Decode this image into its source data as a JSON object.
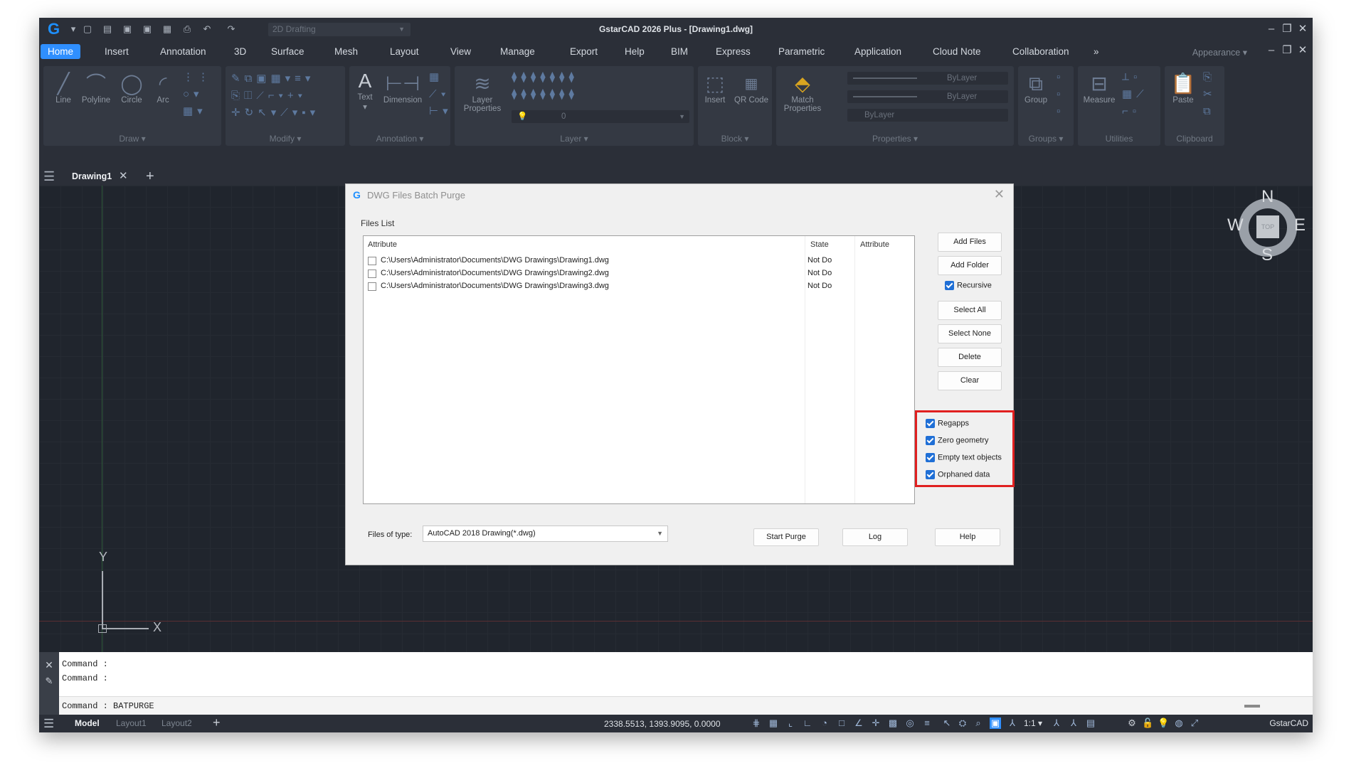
{
  "app": {
    "title": "GstarCAD 2026 Plus - [Drawing1.dwg]",
    "workspace": "2D Drafting",
    "appearance": "Appearance",
    "accent_color": "#2f8fff",
    "window_controls": [
      "minimize-icon",
      "restore-icon",
      "close-icon"
    ]
  },
  "menu": {
    "tabs": [
      "Home",
      "Insert",
      "Annotation",
      "3D",
      "Surface",
      "Mesh",
      "Layout",
      "View",
      "Manage",
      "Export",
      "Help",
      "BIM",
      "Express",
      "Parametric",
      "Application",
      "Cloud Note",
      "Collaboration"
    ],
    "active": "Home"
  },
  "ribbon": {
    "draw": {
      "label": "Draw",
      "tools": [
        "Line",
        "Polyline",
        "Circle",
        "Arc"
      ]
    },
    "modify": {
      "label": "Modify"
    },
    "annotation": {
      "label": "Annotation",
      "tools": [
        "Text",
        "Dimension"
      ]
    },
    "layer": {
      "label": "Layer",
      "tool": "Layer Properties",
      "current_layer": "0"
    },
    "block": {
      "label": "Block",
      "tools": [
        "Insert",
        "QR Code"
      ]
    },
    "properties": {
      "label": "Properties",
      "tool": "Match Properties",
      "color": "ByLayer",
      "linetype": "ByLayer",
      "lineweight": "ByLayer"
    },
    "groups": {
      "label": "Groups",
      "tool": "Group"
    },
    "utilities": {
      "label": "Utilities",
      "tool": "Measure"
    },
    "clipboard": {
      "label": "Clipboard",
      "tool": "Paste"
    }
  },
  "document": {
    "tab": "Drawing1"
  },
  "viewcube": {
    "north": "N",
    "south": "S",
    "east": "E",
    "west": "W",
    "face": "TOP"
  },
  "ucs": {
    "x": "X",
    "y": "Y"
  },
  "dialog": {
    "title": "DWG Files Batch Purge",
    "files_list_label": "Files List",
    "columns": [
      "Attribute",
      "State",
      "Attribute"
    ],
    "files": [
      {
        "path": "C:\\Users\\Administrator\\Documents\\DWG Drawings\\Drawing1.dwg",
        "state": "Not Do"
      },
      {
        "path": "C:\\Users\\Administrator\\Documents\\DWG Drawings\\Drawing2.dwg",
        "state": "Not Do"
      },
      {
        "path": "C:\\Users\\Administrator\\Documents\\DWG Drawings\\Drawing3.dwg",
        "state": "Not Do"
      }
    ],
    "buttons": {
      "add_files": "Add Files",
      "add_folder": "Add Folder",
      "select_all": "Select All",
      "select_none": "Select None",
      "delete": "Delete",
      "clear": "Clear",
      "start_purge": "Start Purge",
      "log": "Log",
      "help": "Help"
    },
    "recursive": {
      "label": "Recursive",
      "checked": true
    },
    "purge_options": [
      {
        "label": "Regapps",
        "checked": true
      },
      {
        "label": "Zero geometry",
        "checked": true
      },
      {
        "label": "Empty text objects",
        "checked": true
      },
      {
        "label": "Orphaned data",
        "checked": true
      }
    ],
    "files_of_type_label": "Files of type:",
    "files_of_type_value": "AutoCAD 2018 Drawing(*.dwg)",
    "highlight_color": "#e02020"
  },
  "command": {
    "lines": [
      "Command :",
      "Command :",
      "Command :  BATPURGE"
    ]
  },
  "status": {
    "layouts": [
      "Model",
      "Layout1",
      "Layout2"
    ],
    "active_layout": "Model",
    "coords": "2338.5513, 1393.9095, 0.0000",
    "scale": "1:1",
    "brand": "GstarCAD"
  }
}
